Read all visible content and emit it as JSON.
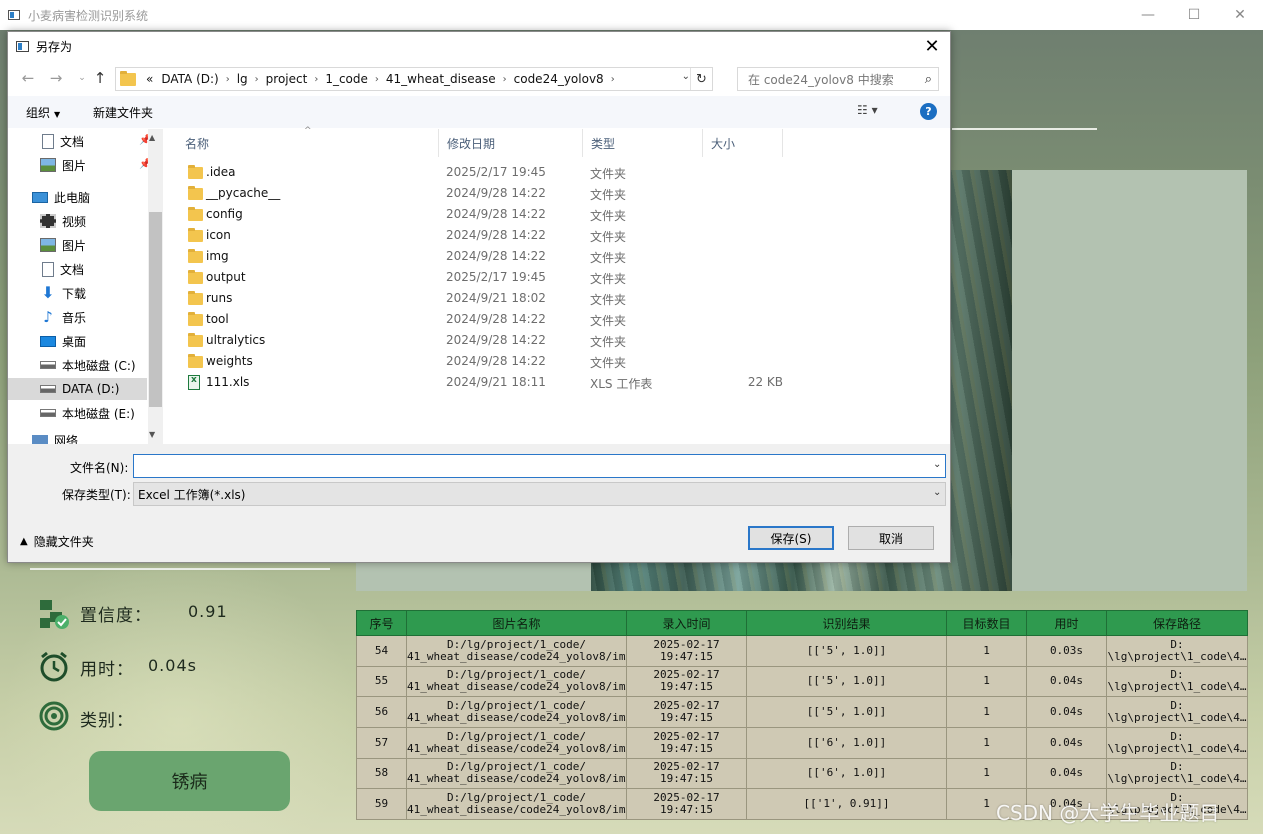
{
  "app": {
    "title": "小麦病害检测识别系统",
    "window_controls": {
      "minimize": "—",
      "maximize": "☐",
      "close": "✕"
    }
  },
  "stats": {
    "confidence_label": "置信度：",
    "confidence_value": "0.91",
    "time_label": "用时：",
    "time_value": "0.04s",
    "class_label": "类别：",
    "class_result": "锈病"
  },
  "results_table": {
    "headers": [
      "序号",
      "图片名称",
      "录入时间",
      "识别结果",
      "目标数目",
      "用时",
      "保存路径"
    ],
    "rows": [
      {
        "id": "54",
        "name1": "D:/lg/project/1_code/",
        "name2": "41_wheat_disease/code24_yolov8/im…",
        "time1": "2025-02-17",
        "time2": "19:47:15",
        "result": "[['5', 1.0]]",
        "count": "1",
        "duration": "0.03s",
        "path1": "D:",
        "path2": "\\lg\\project\\1_code\\4…"
      },
      {
        "id": "55",
        "name1": "D:/lg/project/1_code/",
        "name2": "41_wheat_disease/code24_yolov8/im…",
        "time1": "2025-02-17",
        "time2": "19:47:15",
        "result": "[['5', 1.0]]",
        "count": "1",
        "duration": "0.04s",
        "path1": "D:",
        "path2": "\\lg\\project\\1_code\\4…"
      },
      {
        "id": "56",
        "name1": "D:/lg/project/1_code/",
        "name2": "41_wheat_disease/code24_yolov8/im…",
        "time1": "2025-02-17",
        "time2": "19:47:15",
        "result": "[['5', 1.0]]",
        "count": "1",
        "duration": "0.04s",
        "path1": "D:",
        "path2": "\\lg\\project\\1_code\\4…"
      },
      {
        "id": "57",
        "name1": "D:/lg/project/1_code/",
        "name2": "41_wheat_disease/code24_yolov8/im…",
        "time1": "2025-02-17",
        "time2": "19:47:15",
        "result": "[['6', 1.0]]",
        "count": "1",
        "duration": "0.04s",
        "path1": "D:",
        "path2": "\\lg\\project\\1_code\\4…"
      },
      {
        "id": "58",
        "name1": "D:/lg/project/1_code/",
        "name2": "41_wheat_disease/code24_yolov8/im…",
        "time1": "2025-02-17",
        "time2": "19:47:15",
        "result": "[['6', 1.0]]",
        "count": "1",
        "duration": "0.04s",
        "path1": "D:",
        "path2": "\\lg\\project\\1_code\\4…"
      },
      {
        "id": "59",
        "name1": "D:/lg/project/1_code/",
        "name2": "41_wheat_disease/code24_yolov8/im…",
        "time1": "2025-02-17",
        "time2": "19:47:15",
        "result": "[['1', 0.91]]",
        "count": "1",
        "duration": "0.04s",
        "path1": "D:",
        "path2": "\\lg\\project\\1_code\\4…"
      }
    ]
  },
  "watermark": "CSDN @大学生毕业题目",
  "dialog": {
    "title": "另存为",
    "close": "✕",
    "nav": {
      "back": "←",
      "forward": "→",
      "recent": "⌄",
      "up": "↑"
    },
    "breadcrumbs": [
      "«",
      "DATA (D:)",
      "lg",
      "project",
      "1_code",
      "41_wheat_disease",
      "code24_yolov8"
    ],
    "crumb_sep": "›",
    "address_dropdown": "⌄",
    "refresh": "↻",
    "search_placeholder": "在 code24_yolov8 中搜索",
    "search_icon": "⌕",
    "toolbar": {
      "organize": "组织",
      "organize_caret": "▼",
      "new_folder": "新建文件夹",
      "view": "☷ ▾",
      "help": "?"
    },
    "sidebar": {
      "items": [
        {
          "label": "文档",
          "icon": "document-icon",
          "pinned": true
        },
        {
          "label": "图片",
          "icon": "pictures-icon",
          "pinned": true
        },
        {
          "label": "此电脑",
          "icon": "this-pc-icon",
          "pinned": false
        },
        {
          "label": "视频",
          "icon": "video-icon",
          "pinned": false
        },
        {
          "label": "图片",
          "icon": "pictures-icon",
          "pinned": false
        },
        {
          "label": "文档",
          "icon": "document-icon",
          "pinned": false
        },
        {
          "label": "下载",
          "icon": "download-icon",
          "pinned": false
        },
        {
          "label": "音乐",
          "icon": "music-icon",
          "pinned": false
        },
        {
          "label": "桌面",
          "icon": "desktop-icon",
          "pinned": false
        },
        {
          "label": "本地磁盘 (C:)",
          "icon": "drive-icon",
          "pinned": false
        },
        {
          "label": "DATA (D:)",
          "icon": "drive-icon",
          "pinned": false,
          "selected": true
        },
        {
          "label": "本地磁盘 (E:)",
          "icon": "drive-icon",
          "pinned": false
        },
        {
          "label": "网络",
          "icon": "network-icon",
          "pinned": false
        }
      ],
      "pin_glyph": "📌",
      "scroll_up": "▲",
      "scroll_down": "▼"
    },
    "columns": {
      "name": "名称",
      "date": "修改日期",
      "type": "类型",
      "size": "大小",
      "sort_arrow": "^"
    },
    "files": [
      {
        "name": ".idea",
        "date": "2025/2/17 19:45",
        "type": "文件夹",
        "size": "",
        "kind": "folder"
      },
      {
        "name": "__pycache__",
        "date": "2024/9/28 14:22",
        "type": "文件夹",
        "size": "",
        "kind": "folder"
      },
      {
        "name": "config",
        "date": "2024/9/28 14:22",
        "type": "文件夹",
        "size": "",
        "kind": "folder"
      },
      {
        "name": "icon",
        "date": "2024/9/28 14:22",
        "type": "文件夹",
        "size": "",
        "kind": "folder"
      },
      {
        "name": "img",
        "date": "2024/9/28 14:22",
        "type": "文件夹",
        "size": "",
        "kind": "folder"
      },
      {
        "name": "output",
        "date": "2025/2/17 19:45",
        "type": "文件夹",
        "size": "",
        "kind": "folder"
      },
      {
        "name": "runs",
        "date": "2024/9/21 18:02",
        "type": "文件夹",
        "size": "",
        "kind": "folder"
      },
      {
        "name": "tool",
        "date": "2024/9/28 14:22",
        "type": "文件夹",
        "size": "",
        "kind": "folder"
      },
      {
        "name": "ultralytics",
        "date": "2024/9/28 14:22",
        "type": "文件夹",
        "size": "",
        "kind": "folder"
      },
      {
        "name": "weights",
        "date": "2024/9/28 14:22",
        "type": "文件夹",
        "size": "",
        "kind": "folder"
      },
      {
        "name": "111.xls",
        "date": "2024/9/21 18:11",
        "type": "XLS 工作表",
        "size": "22 KB",
        "kind": "xls"
      }
    ],
    "filename_label": "文件名(N):",
    "filename_value": "",
    "filetype_label": "保存类型(T):",
    "filetype_value": "Excel 工作簿(*.xls)",
    "dropdown_caret": "⌄",
    "hide_folders": "隐藏文件夹",
    "hide_chevron": "▲",
    "save_button": "保存(S)",
    "cancel_button": "取消"
  }
}
